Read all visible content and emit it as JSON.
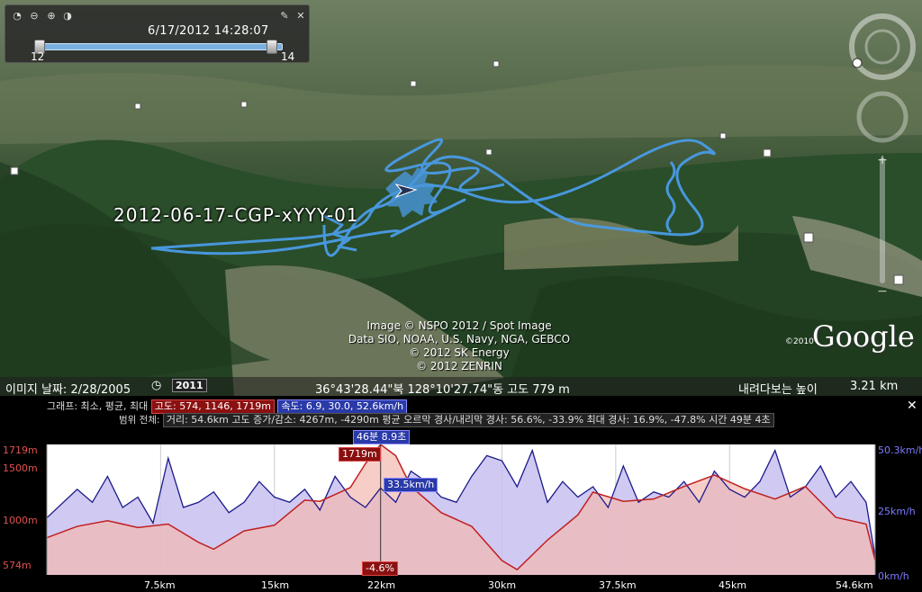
{
  "timeslider": {
    "datetime": "6/17/2012  14:28:07",
    "start_label": "12",
    "end_label": "14",
    "icons": [
      "clock-icon",
      "zoom-out-icon",
      "zoom-in-icon",
      "time-settings-icon",
      "wrench-icon",
      "close-icon"
    ]
  },
  "map": {
    "track_label": "2012-06-17-CGP-xYYY-01",
    "credits": [
      "Image © NSPO 2012 / Spot Image",
      "Data SIO, NOAA, U.S. Navy, NGA, GEBCO",
      "© 2012 SK Energy",
      "© 2012 ZENRIN"
    ],
    "google_logo": "Google",
    "google_year": "©2010",
    "track_color": "#4a9be6"
  },
  "status": {
    "imagery_date_label": "이미지 날짜: 2/28/2005",
    "year_badge": "2011",
    "coordinates": "36°43'28.44\"북 128°10'27.74\"동 고도  779 m",
    "eye_alt_label": "내려다보는 높이",
    "eye_alt_value": "3.21 km"
  },
  "graph": {
    "row1_label": "그래프: 최소, 평균, 최대",
    "altitude_stats": "고도: 574, 1146, 1719m",
    "speed_stats": "속도: 6.9, 30.0, 52.6km/h",
    "row2_label": "범위 전체:",
    "range_stats": "거리: 54.6km  고도 증가/감소: 4267m, -4290m  평균 오르막 경사/내리막 경사: 56.6%, -33.9%  최대 경사: 16.9%, -47.8%  시간  49분 4초",
    "time_flag": "46분 8.9초",
    "alt_flag": "1719m",
    "speed_flag": "33.5km/h",
    "slope_flag": "-4.6%",
    "left_axis": [
      "1719m",
      "1500m",
      "1000m",
      "574m"
    ],
    "right_axis": [
      "50.3km/h",
      "25km/h",
      "0km/h"
    ],
    "x_ticks": [
      "7.5km",
      "15km",
      "22km",
      "30km",
      "37.5km",
      "45km",
      "54.6km"
    ],
    "colors": {
      "altitude": "#c02020",
      "speed": "#1a1a8a",
      "alt_fill": "#f3b8b0",
      "speed_fill": "#c8c0f0"
    }
  },
  "chart_data": {
    "type": "line",
    "x_range_km": [
      0,
      54.6
    ],
    "series": [
      {
        "name": "고도",
        "unit": "m",
        "ylim": [
          574,
          1719
        ],
        "x": [
          0,
          2,
          4,
          6,
          8,
          10,
          11,
          13,
          15,
          17,
          18,
          20,
          21,
          22,
          23,
          24,
          26,
          28,
          30,
          31,
          33,
          35,
          36,
          38,
          40,
          42,
          44,
          46,
          48,
          50,
          52,
          54,
          54.6
        ],
        "values": [
          900,
          1000,
          1050,
          990,
          1020,
          860,
          800,
          960,
          1010,
          1230,
          1220,
          1340,
          1550,
          1719,
          1620,
          1350,
          1120,
          1000,
          700,
          620,
          880,
          1100,
          1300,
          1220,
          1240,
          1350,
          1450,
          1330,
          1240,
          1350,
          1080,
          1020,
          700
        ]
      },
      {
        "name": "속도",
        "unit": "km/h",
        "ylim": [
          0,
          50.3
        ],
        "x": [
          0,
          2,
          3,
          4,
          5,
          6,
          7,
          8,
          9,
          10,
          11,
          12,
          13,
          14,
          15,
          16,
          17,
          18,
          19,
          20,
          21,
          22,
          23,
          24,
          25,
          26,
          27,
          28,
          29,
          30,
          31,
          32,
          33,
          34,
          35,
          36,
          37,
          38,
          39,
          40,
          41,
          42,
          43,
          44,
          45,
          46,
          47,
          48,
          49,
          50,
          51,
          52,
          53,
          54,
          54.6
        ],
        "values": [
          22,
          33,
          28,
          38,
          26,
          30,
          20,
          45,
          26,
          28,
          32,
          24,
          28,
          36,
          30,
          28,
          33,
          25,
          38,
          30,
          26,
          33.5,
          28,
          40,
          36,
          30,
          28,
          38,
          46,
          44,
          34,
          48,
          28,
          36,
          30,
          34,
          26,
          42,
          28,
          32,
          30,
          36,
          28,
          40,
          33,
          30,
          36,
          48,
          30,
          34,
          42,
          30,
          36,
          28,
          6.9
        ]
      }
    ],
    "cursor_km": 22
  }
}
